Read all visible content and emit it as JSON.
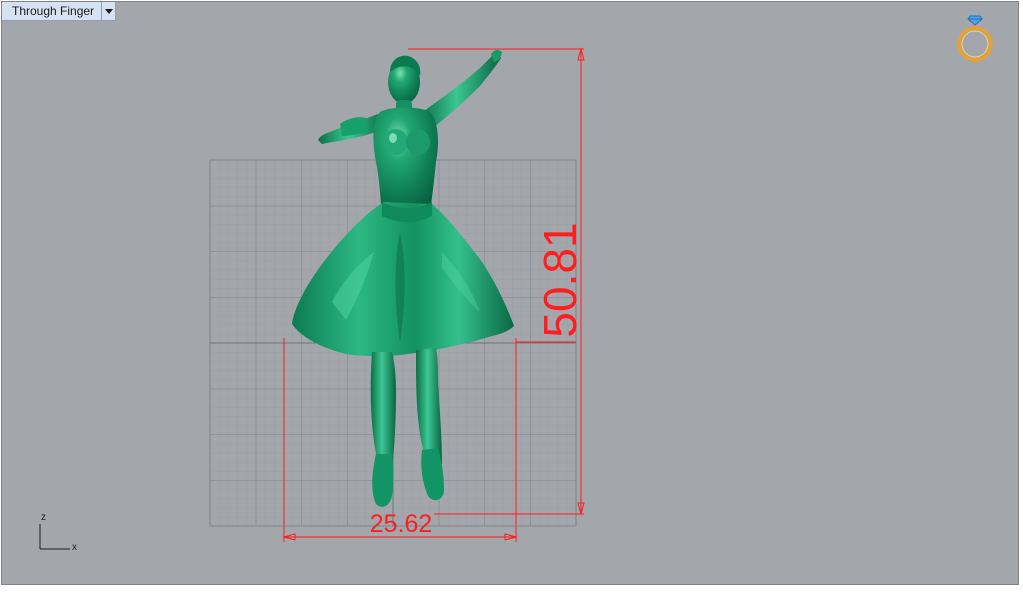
{
  "viewport": {
    "title": "Through Finger"
  },
  "dimensions": {
    "height_value": "50.81",
    "width_value": "25.62"
  },
  "axes": {
    "z_label": "z",
    "x_label": "x"
  },
  "icons": {
    "viewport_menu": "chevron-down-icon",
    "top_right": "ring-icon"
  },
  "colors": {
    "viewport_background": "#a3a6ab",
    "model": "#16905f",
    "dimension": "#ff1e1e",
    "grid": "#8c8f94",
    "tab_background": "#d6e2f2"
  }
}
